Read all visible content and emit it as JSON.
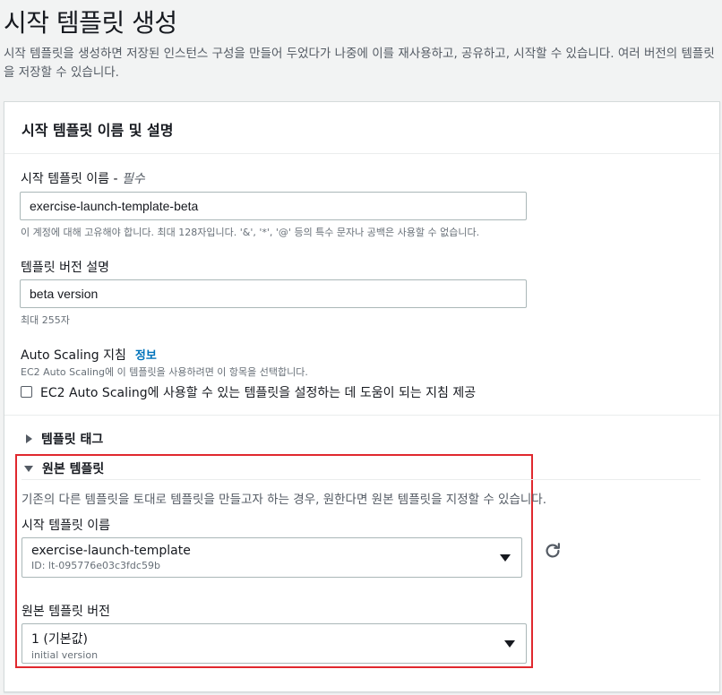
{
  "header": {
    "title": "시작 템플릿 생성",
    "description": "시작 템플릿을 생성하면 저장된 인스턴스 구성을 만들어 두었다가 나중에 이를 재사용하고, 공유하고, 시작할 수 있습니다. 여러 버전의 템플릿을 저장할 수 있습니다."
  },
  "card": {
    "title": "시작 템플릿 이름 및 설명",
    "name_field": {
      "label": "시작 템플릿 이름 - ",
      "required": "필수",
      "value": "exercise-launch-template-beta",
      "hint": "이 계정에 대해 고유해야 합니다. 최대 128자입니다. '&', '*', '@' 등의 특수 문자나 공백은 사용할 수 없습니다."
    },
    "version_desc_field": {
      "label": "템플릿 버전 설명",
      "value": "beta version",
      "hint": "최대 255자"
    },
    "autoscaling": {
      "label": "Auto Scaling 지침",
      "info": "정보",
      "hint": "EC2 Auto Scaling에 이 템플릿을 사용하려면 이 항목을 선택합니다.",
      "checkbox_label": "EC2 Auto Scaling에 사용할 수 있는 템플릿을 설정하는 데 도움이 되는 지침 제공",
      "checked": false
    },
    "template_tags": {
      "label": "템플릿 태그"
    },
    "source_template": {
      "label": "원본 템플릿",
      "description": "기존의 다른 템플릿을 토대로 템플릿을 만들고자 하는 경우, 원한다면 원본 템플릿을 지정할 수 있습니다.",
      "name_label": "시작 템플릿 이름",
      "name_value": "exercise-launch-template",
      "name_id": "ID: lt-095776e03c3fdc59b",
      "version_label": "원본 템플릿 버전",
      "version_value": "1 (기본값)",
      "version_sub": "initial version"
    }
  },
  "colors": {
    "accent": "#0073bb",
    "highlight": "#e0282e"
  },
  "icons": {
    "refresh": "refresh-icon"
  }
}
